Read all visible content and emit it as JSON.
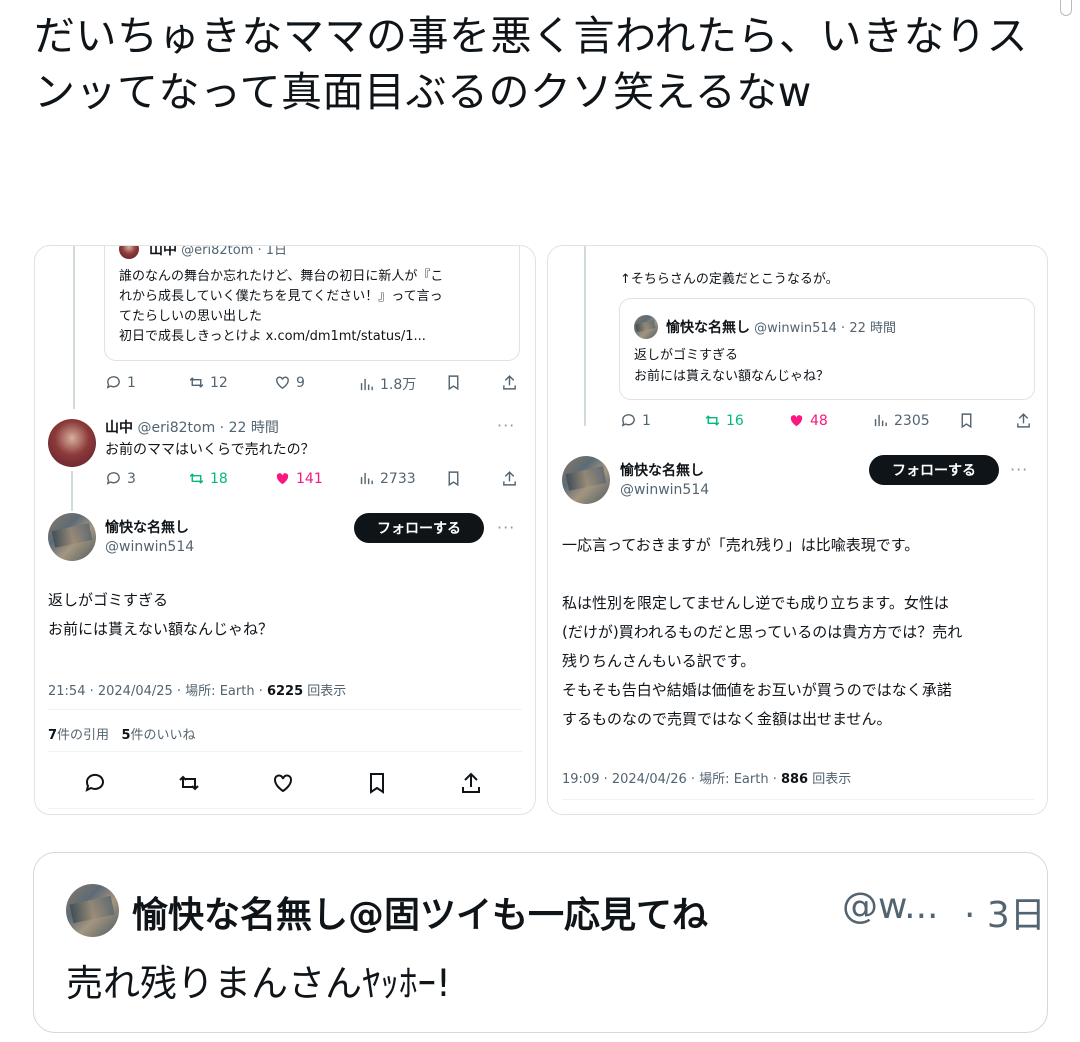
{
  "post": {
    "text": "だいちゅきなママの事を悪く言われたら、いきなりスンッてなって真面目ぶるのクソ笑えるなw"
  },
  "left_card": {
    "quoted_top": {
      "name": "山中",
      "handle": "@eri82tom · 1日",
      "text_lines": [
        "誰のなんの舞台か忘れたけど、舞台の初日に新人が『こ",
        "れから成長していく僕たちを見てください！』って言っ",
        "てたらしいの思い出した",
        "初日で成長しきっとけよ x.com/dm1mt/status/1..."
      ]
    },
    "actions_1": {
      "reply": "1",
      "retweet": "12",
      "like": "9",
      "views": "1.8万"
    },
    "reply_tweet": {
      "name": "山中",
      "handle": "@eri82tom · 22 時間",
      "text": "お前のママはいくらで売れたの？",
      "more": "···"
    },
    "actions_2": {
      "reply": "3",
      "retweet": "18",
      "like": "141",
      "views": "2733"
    },
    "main_tweet": {
      "name": "愉快な名無し",
      "handle": "@winwin514",
      "follow_label": "フォローする",
      "more": "···",
      "text_lines": [
        "返しがゴミすぎる",
        "お前には貰えない額なんじゃね？"
      ],
      "meta_prefix": "21:54 · 2024/04/25 · 場所: Earth · ",
      "meta_views": "6225",
      "meta_suffix": " 回表示",
      "quote_count": "7",
      "quote_label": "件の引用",
      "like_count": "5",
      "like_label": "件のいいね"
    }
  },
  "right_card": {
    "top_text": "↑そちらさんの定義だとこうなるが。",
    "quoted": {
      "name": "愉快な名無し",
      "handle": "@winwin514 · 22 時間",
      "text_lines": [
        "返しがゴミすぎる",
        "お前には貰えない額なんじゃね？"
      ]
    },
    "actions_1": {
      "reply": "1",
      "retweet": "16",
      "like": "48",
      "views": "2305"
    },
    "main_tweet": {
      "name": "愉快な名無し",
      "handle": "@winwin514",
      "follow_label": "フォローする",
      "more": "···",
      "text_lines": [
        "一応言っておきますが「売れ残り」は比喩表現です。",
        "",
        "私は性別を限定してませんし逆でも成り立ちます。女性は",
        "(だけが)買われるものだと思っているのは貴方方では？売れ",
        "残りちんさんもいる訳です。",
        "そもそも告白や結婚は価値をお互いが買うのではなく承諾",
        "するものなので売買ではなく金額は出せません。"
      ],
      "meta_prefix": "19:09 · 2024/04/26 · 場所: Earth · ",
      "meta_views": "886",
      "meta_suffix": " 回表示"
    }
  },
  "quote_tweet": {
    "name": "愉快な名無し@固ツイも一応見てね",
    "handle": "@w...",
    "time": "· 3日",
    "text": "売れ残りまんさんﾔｯﾎｰ!"
  },
  "colors": {
    "accent_like": "#f91880",
    "accent_retweet": "#00ba7c",
    "text": "#0f1419",
    "muted": "#536471"
  }
}
